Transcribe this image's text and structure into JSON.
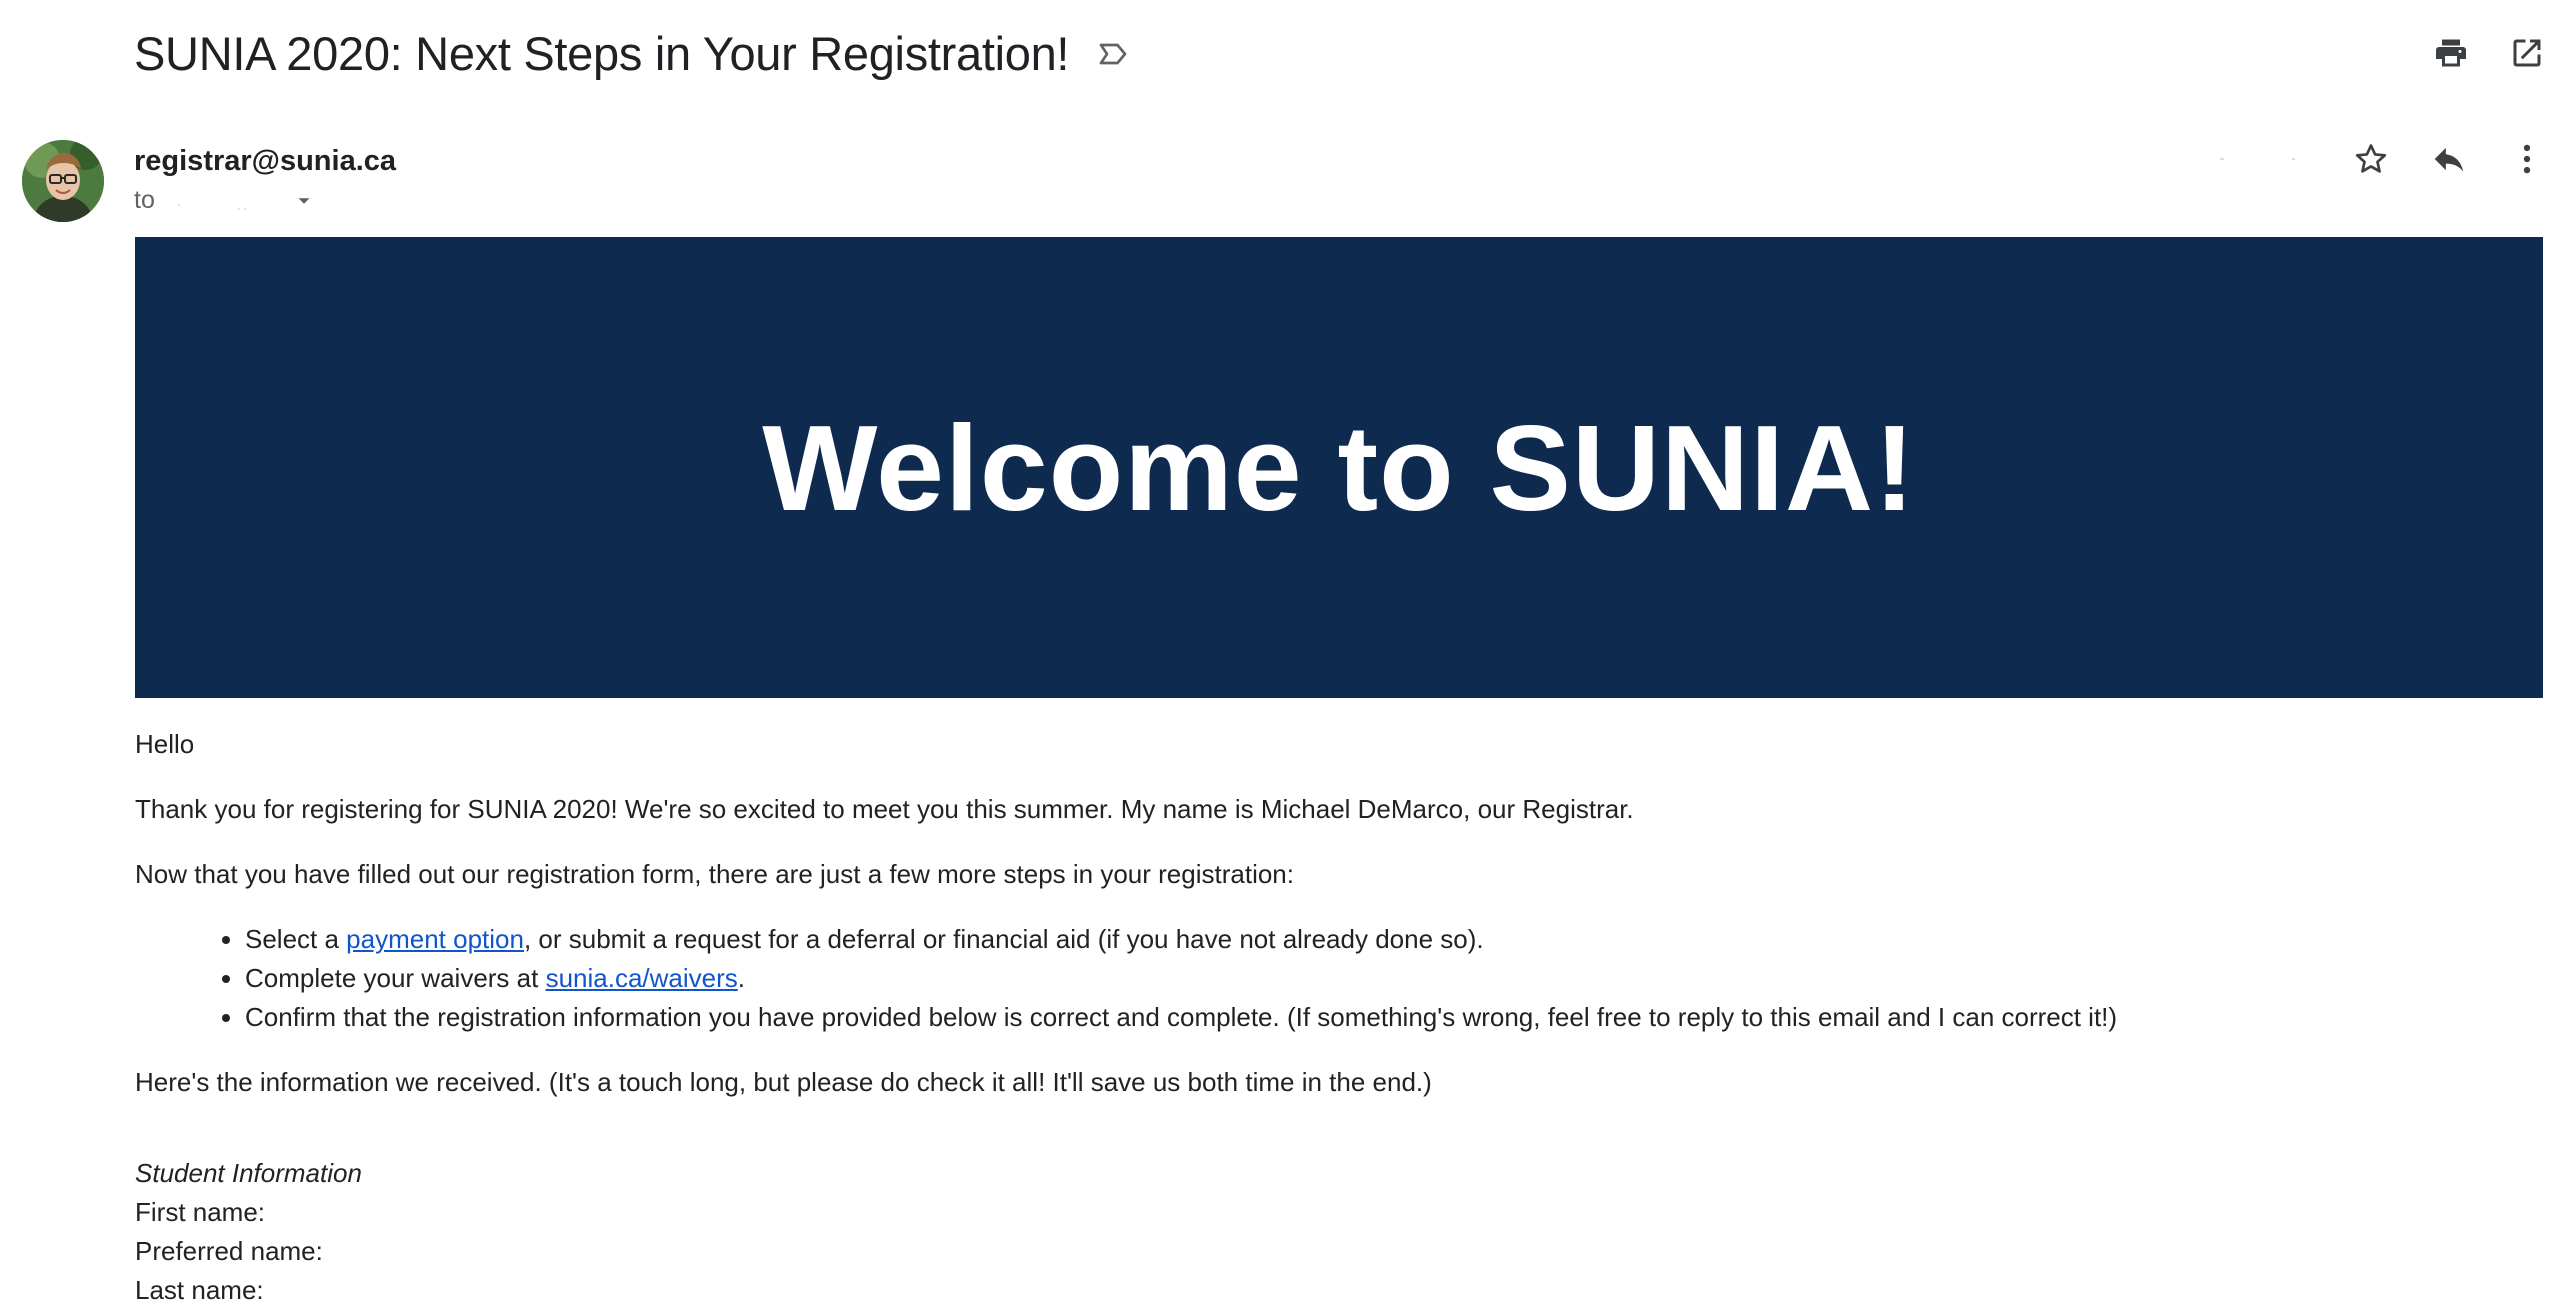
{
  "email": {
    "subject": "SUNIA 2020: Next Steps in Your Registration!",
    "sender": "registrar@sunia.ca",
    "to_label": "to"
  },
  "banner": {
    "text": "Welcome to SUNIA!",
    "background": "#0f2a4f"
  },
  "body": {
    "greeting": "Hello",
    "intro": "Thank you for registering for SUNIA 2020! We're so excited to meet you this summer. My name is Michael DeMarco, our Registrar.",
    "steps_intro": "Now that you have filled out our registration form, there are just a few more steps in your registration:",
    "steps": {
      "step1_prefix": "Select a ",
      "step1_link": "payment option",
      "step1_suffix": ", or submit a request for a deferral or financial aid (if you have not already done so).",
      "step2_prefix": "Complete your waivers at ",
      "step2_link": "sunia.ca/waivers",
      "step2_suffix": ".",
      "step3": "Confirm that the registration information you have provided below is correct and complete. (If something's wrong, feel free to reply to this email and I can correct it!)"
    },
    "info_intro": "Here's the information we received. (It's a touch long, but please do check it all! It'll save us both time in the end.)",
    "student_info": {
      "title": "Student Information",
      "first_name_label": "First name:",
      "preferred_name_label": "Preferred name:",
      "last_name_label": "Last name:"
    }
  },
  "icons": {
    "label": "label-outline-icon",
    "print": "print-icon",
    "open_new_window": "open-in-new-icon",
    "star": "star-outline-icon",
    "reply": "reply-icon",
    "more": "more-vert-icon",
    "dropdown": "arrow-drop-down-icon"
  },
  "colors": {
    "link": "#1155cc",
    "text": "#222222",
    "icon": "#5f6368"
  }
}
